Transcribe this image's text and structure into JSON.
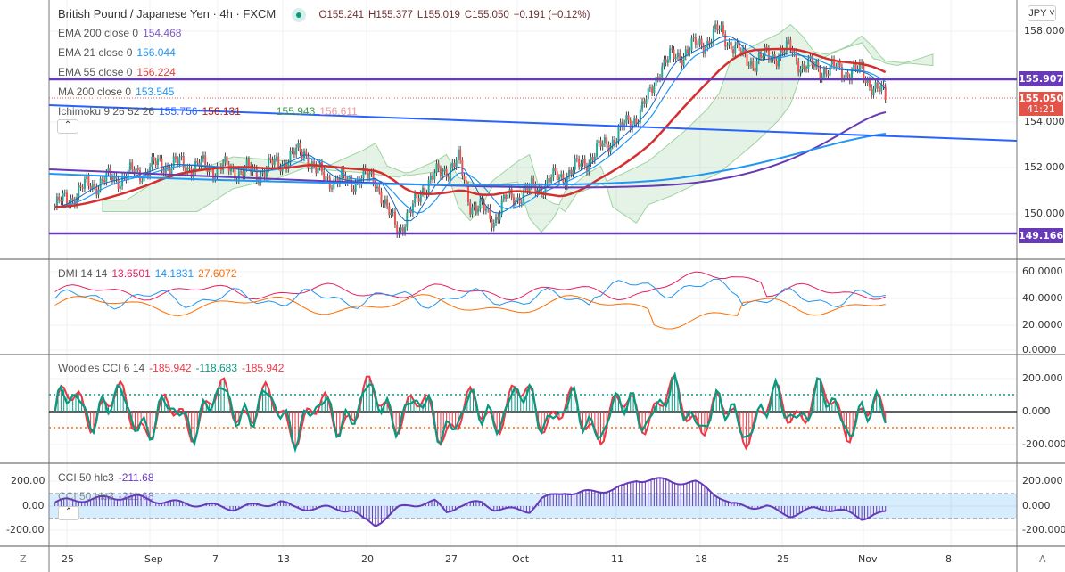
{
  "header": {
    "symbol": "British Pound / Japanese Yen · 4h · FXCM",
    "open": "O155.241",
    "high": "H155.377",
    "low": "L155.019",
    "close": "C155.050",
    "change": "−0.191 (−0.12%)"
  },
  "legends": [
    {
      "label": "EMA 200 close 0",
      "values": [
        {
          "v": "154.468",
          "c": "#7e57c2"
        }
      ]
    },
    {
      "label": "EMA 21 close 0",
      "values": [
        {
          "v": "156.044",
          "c": "#2196f3"
        }
      ]
    },
    {
      "label": "EMA 55 close 0",
      "values": [
        {
          "v": "156.224",
          "c": "#e53935"
        }
      ]
    },
    {
      "label": "MA 200 close 0",
      "values": [
        {
          "v": "153.545",
          "c": "#2196f3"
        }
      ]
    },
    {
      "label": "Ichimoku 9 26 52 26",
      "values": [
        {
          "v": "155.756",
          "c": "#2962ff"
        },
        {
          "v": "156.131",
          "c": "#b71c1c"
        },
        {
          "v": "155.943",
          "c": "#43a047"
        },
        {
          "v": "156.611",
          "c": "#ef9a9a"
        }
      ]
    }
  ],
  "dmi": {
    "label": "DMI 14 14",
    "v1": "13.6501",
    "v2": "14.1831",
    "v3": "27.6072"
  },
  "woodies": {
    "label": "Woodies CCI 6 14",
    "v1": "-185.942",
    "v2": "-118.683",
    "v3": "-185.942"
  },
  "cci": {
    "label": "CCI 50 hlc3",
    "value": "-211.68"
  },
  "currency": "JPY",
  "price_axis": [
    "158.000",
    "154.000",
    "152.000",
    "150.000"
  ],
  "price_tags": {
    "upper": "155.907",
    "lower": "149.166",
    "last": "155.050",
    "countdown": "41:21"
  },
  "dmi_axis": [
    "60.0000",
    "40.0000",
    "20.0000",
    "0.0000"
  ],
  "woodies_axis": [
    "200.000",
    "0.000",
    "-200.000"
  ],
  "cci_axis_left": [
    "200.00",
    "0.00",
    "-200.00"
  ],
  "cci_axis_right": [
    "200.000",
    "0.000",
    "-200.000"
  ],
  "time_axis": [
    "25",
    "Sep",
    "7",
    "13",
    "20",
    "27",
    "Oct",
    "11",
    "18",
    "25",
    "Nov",
    "8"
  ],
  "colors": {
    "bull": "#26a69a",
    "bear": "#ef5350",
    "purple": "#673ab7"
  },
  "chart_data": {
    "type": "candlestick",
    "days_from_aug24": [
      0,
      3,
      7,
      9,
      14,
      17,
      20,
      21,
      22,
      24,
      27,
      28,
      29,
      30,
      31,
      33,
      34,
      35,
      37,
      38,
      40,
      42,
      44,
      47,
      49,
      50,
      51,
      53,
      55,
      56,
      57,
      58,
      59,
      62,
      63,
      64,
      66,
      68,
      69,
      70
    ],
    "close": [
      150.3,
      151.3,
      151.8,
      152.2,
      152.0,
      151.8,
      152.5,
      152.8,
      151.8,
      151.4,
      151.6,
      150.0,
      149.4,
      150.0,
      151.2,
      152.0,
      152.3,
      150.5,
      149.8,
      150.6,
      151.0,
      151.5,
      152.0,
      153.3,
      154.3,
      155.0,
      156.5,
      157.1,
      157.6,
      158.0,
      157.5,
      156.8,
      156.7,
      157.2,
      156.5,
      156.4,
      156.3,
      156.2,
      155.6,
      155.05
    ]
  }
}
